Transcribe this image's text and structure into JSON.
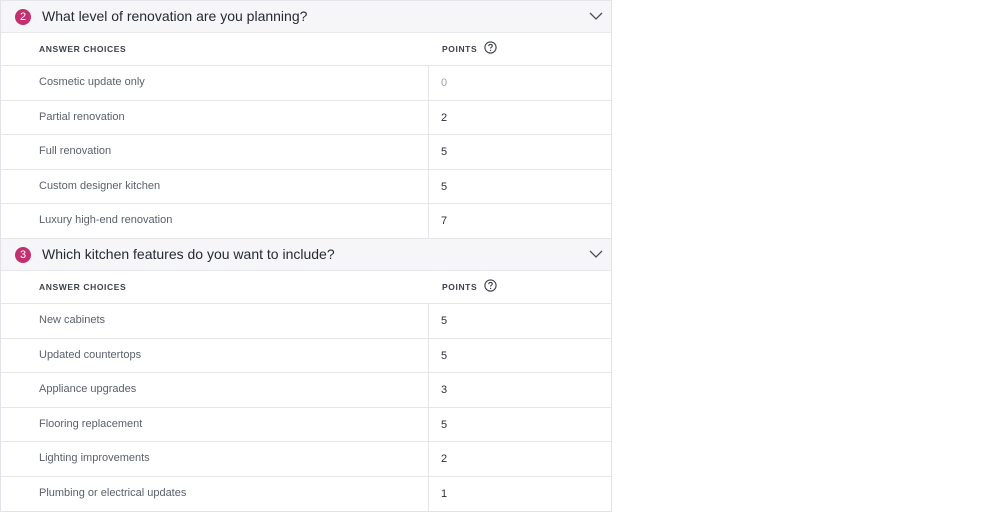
{
  "questions": [
    {
      "number": "2",
      "title": "What level of renovation are you planning?",
      "answers_header": "ANSWER CHOICES",
      "points_header": "POINTS",
      "choices": [
        {
          "label": "Cosmetic update only",
          "points": "0"
        },
        {
          "label": "Partial renovation",
          "points": "2"
        },
        {
          "label": "Full renovation",
          "points": "5"
        },
        {
          "label": "Custom designer kitchen",
          "points": "5"
        },
        {
          "label": "Luxury high-end renovation",
          "points": "7"
        }
      ]
    },
    {
      "number": "3",
      "title": "Which kitchen features do you want to include?",
      "answers_header": "ANSWER CHOICES",
      "points_header": "POINTS",
      "choices": [
        {
          "label": "New cabinets",
          "points": "5"
        },
        {
          "label": "Updated countertops",
          "points": "5"
        },
        {
          "label": "Appliance upgrades",
          "points": "3"
        },
        {
          "label": "Flooring replacement",
          "points": "5"
        },
        {
          "label": "Lighting improvements",
          "points": "2"
        },
        {
          "label": "Plumbing or electrical updates",
          "points": "1"
        }
      ]
    }
  ],
  "colors": {
    "badge": "#c2306f",
    "header_bg": "#f6f6f8",
    "border": "#e4e6ea"
  },
  "icons": {
    "collapse": "chevron-down-icon",
    "help": "question-circle-icon"
  }
}
